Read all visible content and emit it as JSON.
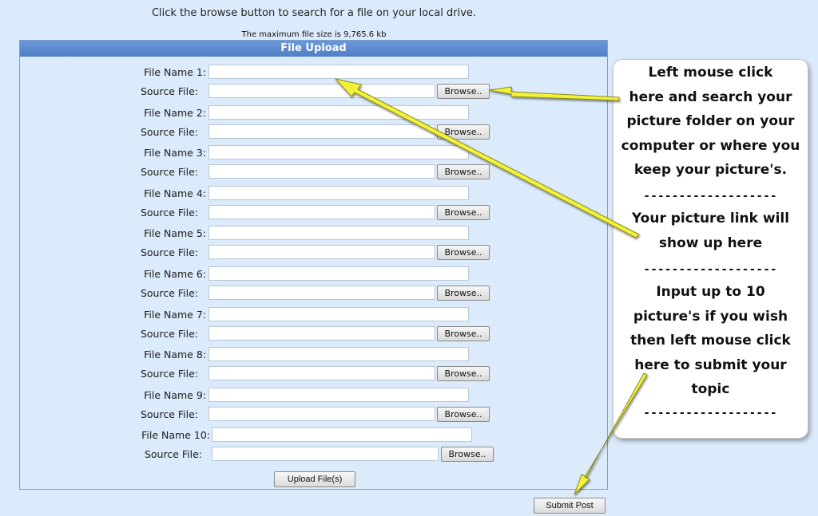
{
  "instruction": "Click the browse button to search for a file on your local drive.",
  "max_size": "The maximum file size is 9,765.6 kb",
  "panel": {
    "title": "File Upload",
    "browse_label": "Browse..",
    "upload_label": "Upload File(s)",
    "rows": [
      {
        "file_label": "File Name 1:",
        "source_label": "Source File:"
      },
      {
        "file_label": "File Name 2:",
        "source_label": "Source File:"
      },
      {
        "file_label": "File Name 3:",
        "source_label": "Source File:"
      },
      {
        "file_label": "File Name 4:",
        "source_label": "Source File:"
      },
      {
        "file_label": "File Name 5:",
        "source_label": "Source File:"
      },
      {
        "file_label": "File Name 6:",
        "source_label": "Source File:"
      },
      {
        "file_label": "File Name 7:",
        "source_label": "Source File:"
      },
      {
        "file_label": "File Name 8:",
        "source_label": "Source File:"
      },
      {
        "file_label": "File Name 9:",
        "source_label": "Source File:"
      },
      {
        "file_label": "File Name 10:",
        "source_label": "Source File:"
      }
    ]
  },
  "submit_label": "Submit Post",
  "callout": {
    "para1": [
      "Left mouse click",
      "here and search your",
      "picture folder on your",
      "computer or where you",
      "keep your picture's."
    ],
    "para2": [
      "Your picture link will",
      "show up here"
    ],
    "para3": [
      "Input up to 10",
      "picture's if you wish",
      "then left mouse click",
      "here to submit your",
      "topic"
    ],
    "divider": "-------------------"
  },
  "colors": {
    "background": "#dcebfb",
    "header": "#5b88cc",
    "arrow": "#f2f23a"
  }
}
